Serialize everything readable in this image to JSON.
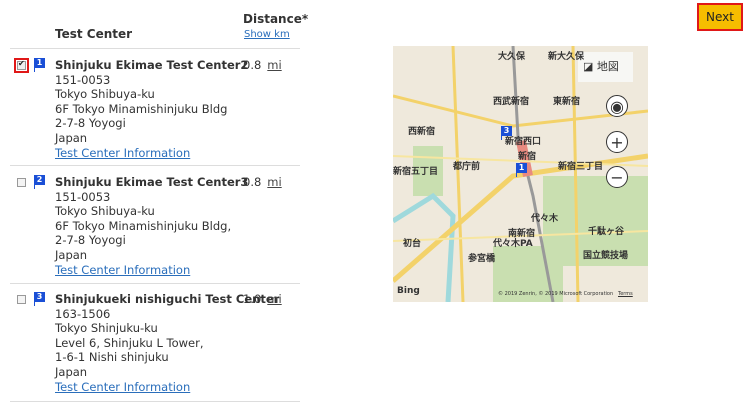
{
  "header": {
    "test_center": "Test Center",
    "distance": "Distance*",
    "show_km": "Show km"
  },
  "next_label": "Next",
  "results": [
    {
      "index": "1",
      "checked": true,
      "name": "Shinjuku Ekimae Test Center2",
      "lines": [
        "151-0053",
        "Tokyo Shibuya-ku",
        "6F Tokyo Minamishinjuku Bldg",
        "2-7-8 Yoyogi",
        "Japan"
      ],
      "info_link": "Test Center Information",
      "distance": "0.8",
      "unit": "mi"
    },
    {
      "index": "2",
      "checked": false,
      "name": "Shinjuku Ekimae Test Center3",
      "lines": [
        "151-0053",
        "Tokyo Shibuya-ku",
        "6F Tokyo Minamishinjuku Bldg,",
        "2-7-8 Yoyogi",
        "Japan"
      ],
      "info_link": "Test Center Information",
      "distance": "0.8",
      "unit": "mi"
    },
    {
      "index": "3",
      "checked": false,
      "name": "Shinjukueki nishiguchi Test Center",
      "lines": [
        "163-1506",
        "Tokyo Shinjuku-ku",
        "Level 6, Shinjuku L Tower,",
        "1-6-1 Nishi shinjuku",
        "Japan"
      ],
      "info_link": "Test Center Information",
      "distance": "1.0",
      "unit": "mi"
    }
  ],
  "map": {
    "type_label": "地図",
    "bing": "Bing",
    "copyright": "© 2019 Zenrin, © 2019 Microsoft Corporation",
    "terms": "Terms",
    "labels": [
      "大久保",
      "新大久保",
      "西武新宿",
      "東新宿",
      "西新宿",
      "新宿西口",
      "新宿",
      "都庁前",
      "新宿三丁目",
      "新宿五丁目",
      "代々木",
      "南新宿",
      "初台",
      "参宮橋",
      "千駄ヶ谷",
      "国立競技場",
      "代々木PA"
    ]
  }
}
